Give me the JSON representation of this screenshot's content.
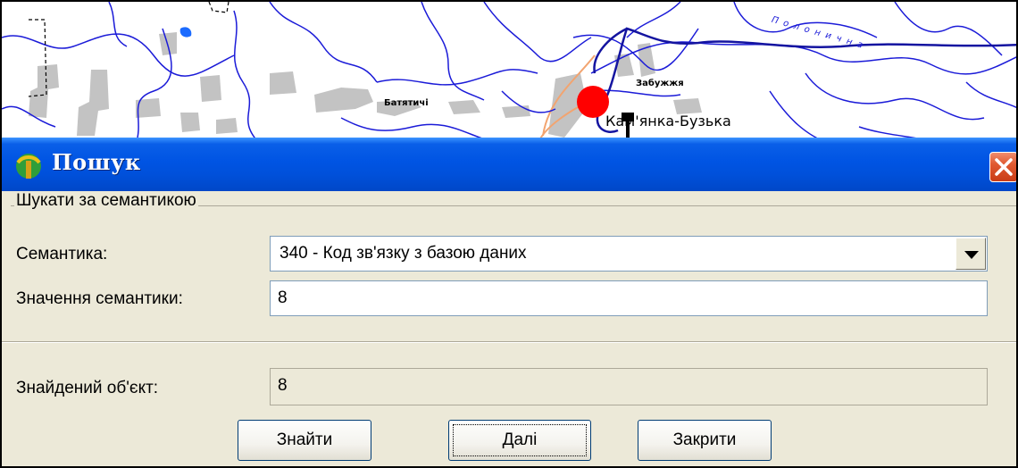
{
  "map": {
    "labels": {
      "village_batiatychi": "Батятичі",
      "village_zabuzhzhia": "Забужжя",
      "town": "Кам'янка-Бузька",
      "river": "Полонична"
    },
    "colors": {
      "rivers": "#1b1bd8",
      "roads": "#f2a470",
      "settlements": "#c3c3c3",
      "marker": "#ff0000"
    }
  },
  "dialog": {
    "title": "Пошук",
    "icon": "app-icon",
    "close_icon": "close-icon",
    "group_title": "Шукати за семантикою",
    "semantics_label": "Семантика:",
    "semantics_value": "340 - Код зв'язку з базою даних",
    "value_label": "Значення семантики:",
    "value_input": "8",
    "found_label": "Знайдений об'єкт:",
    "found_value": "8",
    "buttons": {
      "find": "Знайти",
      "next": "Далі",
      "close": "Закрити"
    }
  },
  "colors": {
    "titlebar": "#0054e3",
    "dialog_bg": "#ece9d8",
    "close_button": "#e05a31"
  }
}
